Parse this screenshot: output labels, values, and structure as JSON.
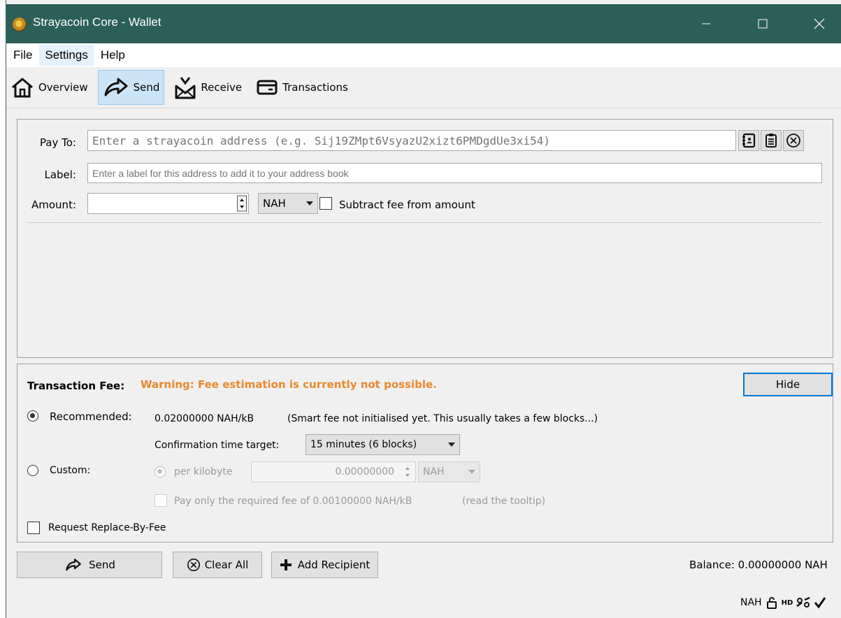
{
  "window": {
    "title": "Strayacoin Core - Wallet"
  },
  "menu": [
    {
      "label": "File"
    },
    {
      "label": "Settings"
    },
    {
      "label": "Help"
    }
  ],
  "toolbar": {
    "overview": "Overview",
    "send": "Send",
    "receive": "Receive",
    "transactions": "Transactions"
  },
  "recipient": {
    "pay_to_label": "Pay To:",
    "pay_to_placeholder": "Enter a strayacoin address (e.g. Sij19ZMpt6VsyazU2xizt6PMDgdUe3xi54)",
    "label_label": "Label:",
    "label_placeholder": "Enter a label for this address to add it to your address book",
    "amount_label": "Amount:",
    "amount_value": "",
    "unit": "NAH",
    "subtract_fee": "Subtract fee from amount"
  },
  "fee": {
    "heading": "Transaction Fee:",
    "warning": "Warning: Fee estimation is currently not possible.",
    "hide_button": "Hide",
    "recommended_label": "Recommended:",
    "recommended_value": "0.02000000 NAH/kB",
    "recommended_note": "(Smart fee not initialised yet. This usually takes a few blocks...)",
    "confirmation_label": "Confirmation time target:",
    "confirmation_value": "15 minutes (6 blocks)",
    "custom_label": "Custom:",
    "per_kilobyte": "per kilobyte",
    "custom_amount": "0.00000000",
    "custom_unit": "NAH",
    "pay_required": "Pay only the required fee of 0.00100000 NAH/kB",
    "read_tooltip": "(read the tooltip)",
    "rbf": "Request Replace-By-Fee",
    "warning_color": "#e8892a"
  },
  "actions": {
    "send": "Send",
    "clear_all": "Clear All",
    "add_recipient": "Add Recipient",
    "balance": "Balance: 0.00000000 NAH"
  },
  "status": {
    "unit": "NAH",
    "hd": "HD"
  }
}
